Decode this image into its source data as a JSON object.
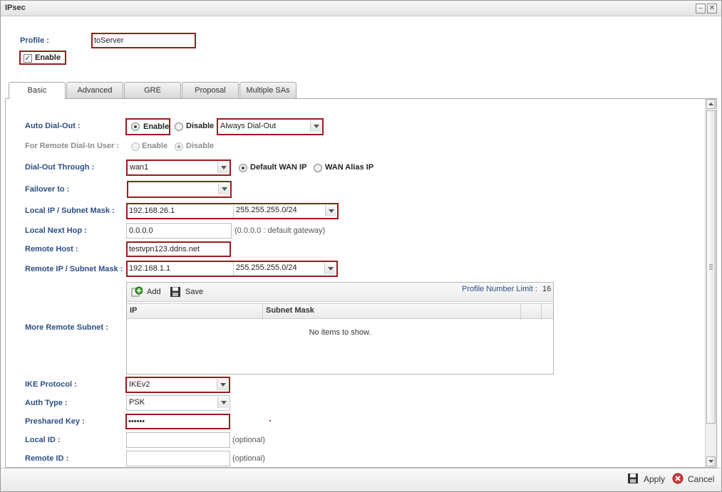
{
  "window": {
    "title": "IPsec",
    "min_label": "–",
    "close_label": "✕"
  },
  "profile": {
    "label": "Profile :",
    "value": "toServer",
    "enable_label": "Enable",
    "enable_checked": true
  },
  "tabs": [
    {
      "label": "Basic",
      "active": true
    },
    {
      "label": "Advanced",
      "active": false
    },
    {
      "label": "GRE",
      "active": false
    },
    {
      "label": "Proposal",
      "active": false
    },
    {
      "label": "Multiple SAs",
      "active": false
    }
  ],
  "form": {
    "auto_dialout": {
      "label": "Auto Dial-Out :",
      "enable": "Enable",
      "disable": "Disable",
      "mode": "Always Dial-Out"
    },
    "remote_dialin": {
      "label": "For Remote Dial-In User :",
      "enable": "Enable",
      "disable": "Disable"
    },
    "dialout_through": {
      "label": "Dial-Out Through :",
      "value": "wan1",
      "default_ip": "Default WAN IP",
      "alias_ip": "WAN Alias IP"
    },
    "failover": {
      "label": "Failover to :",
      "value": ""
    },
    "local_ip": {
      "label": "Local IP / Subnet Mask :",
      "ip": "192.168.26.1",
      "mask": "255.255.255.0/24"
    },
    "local_next_hop": {
      "label": "Local Next Hop :",
      "value": "0.0.0.0",
      "hint": "(0.0.0.0 : default gateway)"
    },
    "remote_host": {
      "label": "Remote Host :",
      "value": "testvpn123.ddns.net"
    },
    "remote_ip": {
      "label": "Remote IP / Subnet Mask :",
      "ip": "192.168.1.1",
      "mask": "255.255.255.0/24"
    },
    "more_remote_subnet": {
      "label": "More Remote Subnet :",
      "add_label": "Add",
      "save_label": "Save",
      "limit_label": "Profile Number Limit :",
      "limit_value": "16",
      "columns": [
        "IP",
        "Subnet Mask"
      ],
      "empty_text": "No items to show."
    },
    "ike_protocol": {
      "label": "IKE Protocol :",
      "value": "IKEv2"
    },
    "auth_type": {
      "label": "Auth Type :",
      "value": "PSK"
    },
    "preshared_key": {
      "label": "Preshared Key :",
      "value": "••••••"
    },
    "local_id": {
      "label": "Local ID :",
      "value": "",
      "hint": "(optional)"
    },
    "remote_id": {
      "label": "Remote ID :",
      "value": "",
      "hint": "(optional)"
    }
  },
  "footer": {
    "apply_label": "Apply",
    "cancel_label": "Cancel"
  },
  "colors": {
    "highlight_border": "#9b1b1b",
    "label_blue": "#2b4f86"
  }
}
